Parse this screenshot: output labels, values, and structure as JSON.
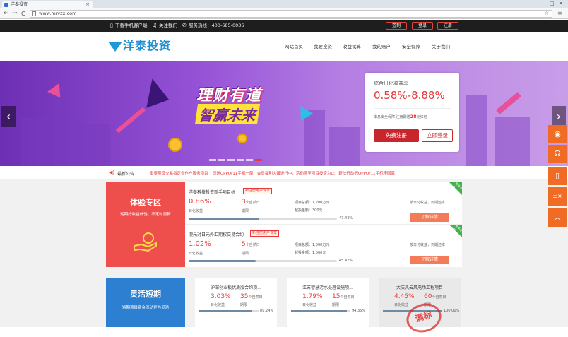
{
  "browser": {
    "tab_title": "洋泰投资",
    "url": "www.mrvzx.com",
    "back": "←",
    "forward": "→",
    "reload": "C",
    "minimize": "–",
    "maximize": "□",
    "close": "✕"
  },
  "topbar": {
    "download_app": "下载手机客户端",
    "follow": "关注我们",
    "hotline": "服务热线：400-685-0036",
    "signin": "签到",
    "login": "登录",
    "register": "注册"
  },
  "header": {
    "logo_text": "洋泰投资",
    "nav": [
      "网站首页",
      "我要投资",
      "收益试算",
      "我的账户",
      "安全保障",
      "关于我们"
    ]
  },
  "banner": {
    "headline1": "理财有道",
    "headline2": "智赢未来",
    "rate_title": "综合日化收益率",
    "rate_value": "0.58%-8.88%",
    "note_prefix": "本息安全保障 注册即送",
    "note_amount": "28",
    "note_suffix": "元红包",
    "register_btn": "免费注册",
    "login_btn": "立即登录",
    "prev": "‹",
    "next": "›"
  },
  "notice": {
    "label": "最新公告",
    "text": "重要期货交易指定合作户服务项目 ” 即送OPPOr11手机一部！会员福利火爆进行中，活动期至项目投资为止，赶快行动把OPPOr11手机带回家！"
  },
  "experience": {
    "title": "体验专区",
    "subtitle": "短期好收益体验，不定时更新",
    "products": [
      {
        "name": "洋泰科技投资新手项目标",
        "tag": "新注册用户专享",
        "rate": "0.86%",
        "rate_label": "日化收益",
        "term": "3",
        "term_unit": "个自然日",
        "term_label": "期限",
        "total": "项目总额：1,200万元",
        "min": "起投金额：300元",
        "progress": 47.44,
        "progress_text": "47.44%",
        "payment": "按日付收益，到期还本",
        "btn": "了解详情",
        "corner": "新手专享"
      },
      {
        "name": "澳元对日元外汇期权交易合约",
        "tag": "新注册用户专享",
        "rate": "1.02%",
        "rate_label": "日化收益",
        "term": "5",
        "term_unit": "个自然日",
        "term_label": "期限",
        "total": "项目总额：1,000万元",
        "min": "起投金额：1,000元",
        "progress": 45.42,
        "progress_text": "45.42%",
        "payment": "按日付收益，到期还本",
        "btn": "了解详情",
        "corner": "新手专享"
      }
    ]
  },
  "flex": {
    "title": "灵活短期",
    "subtitle": "短期项目资金流动更为灵活",
    "cards": [
      {
        "name": "沪深创业板优质股合约项...",
        "rate": "3.03%",
        "term": "35",
        "term_unit": "个自然日",
        "rate_label": "日化收益",
        "term_label": "期限",
        "progress": 89.24,
        "progress_text": "89.24%"
      },
      {
        "name": "江苏智慧污水处理设施项...",
        "rate": "1.79%",
        "term": "15",
        "term_unit": "个自然日",
        "rate_label": "日化收益",
        "term_label": "期限",
        "progress": 94.35,
        "progress_text": "94.35%"
      },
      {
        "name": "大庆风云风电场工程项目",
        "rate": "4.45%",
        "term": "60",
        "term_unit": "个自然日",
        "rate_label": "日化收益",
        "term_label": "期限",
        "progress": 100.0,
        "progress_text": "100.00%"
      }
    ],
    "stamp": "满标"
  },
  "side_tools": [
    "qq-icon",
    "headset-icon",
    "phone-icon",
    "calculator-icon",
    "top-arrow-icon"
  ],
  "colors": {
    "red": "#e8383b",
    "orange": "#f06b24",
    "blue": "#2d7fd1",
    "logo_blue": "#1d8fd0"
  }
}
